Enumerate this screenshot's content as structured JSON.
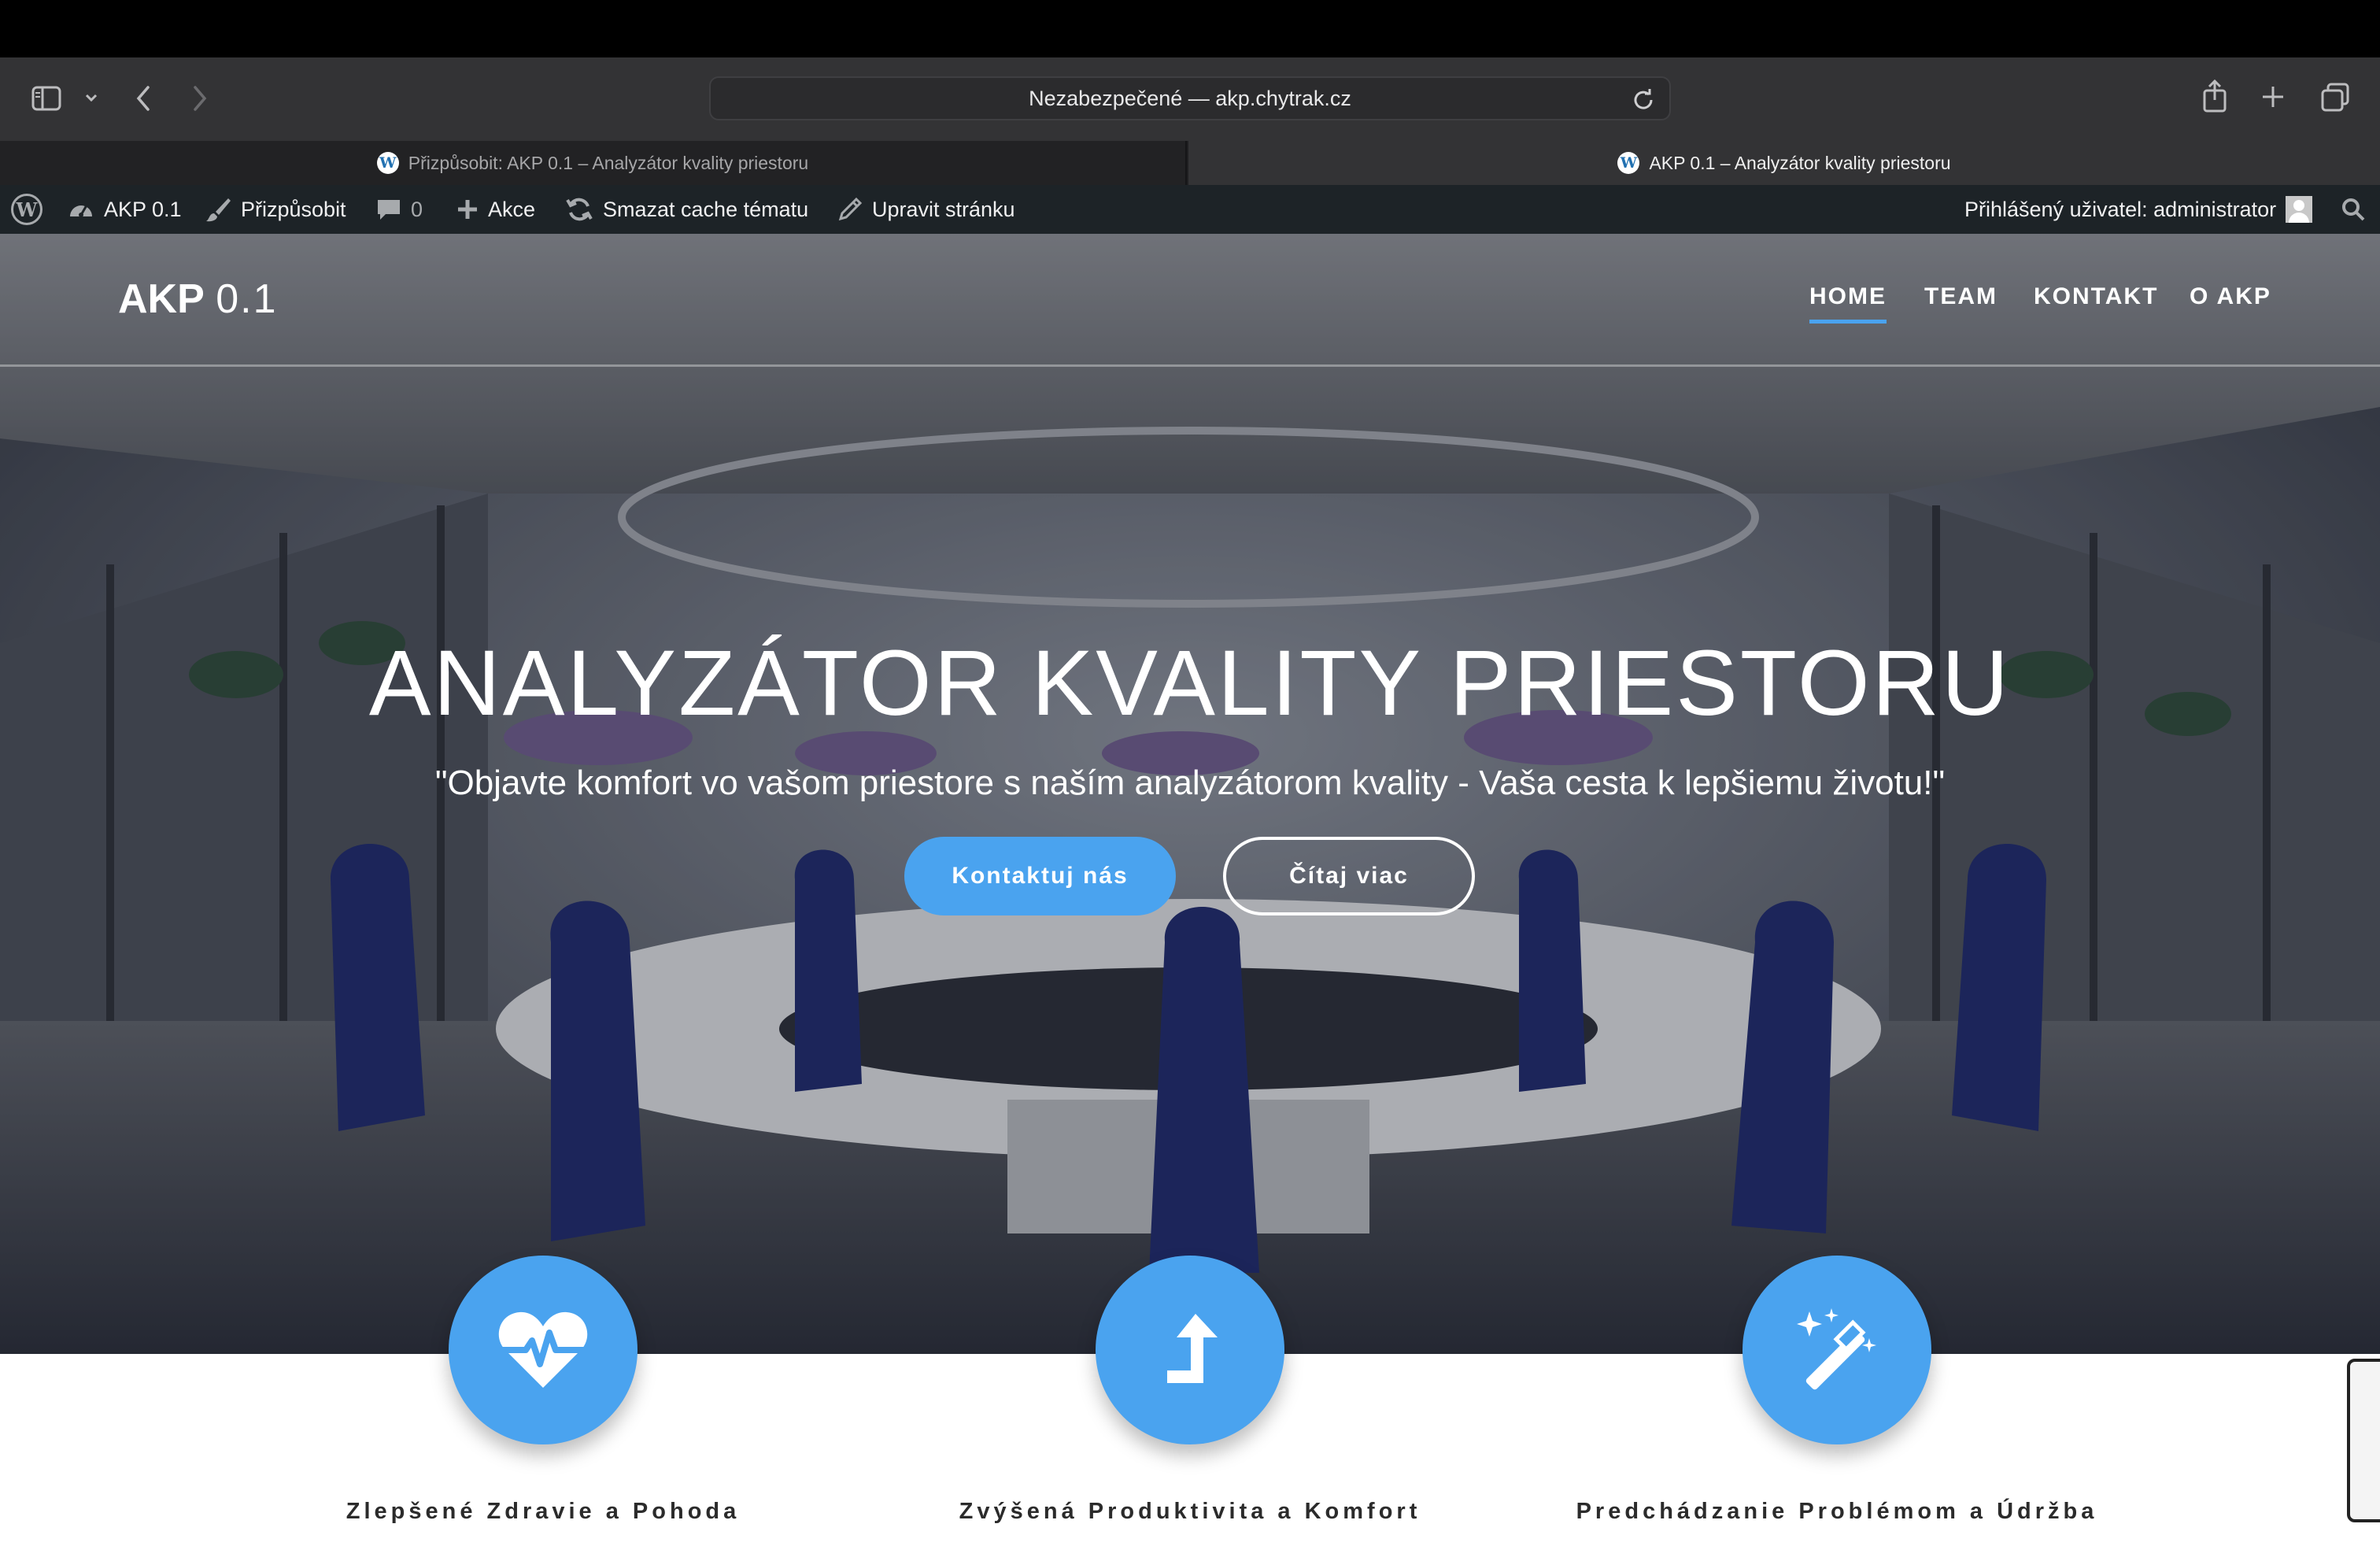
{
  "browser": {
    "address": "Nezabezpečené — akp.chytrak.cz",
    "tabs": [
      {
        "label": "Přizpůsobit: AKP 0.1 – Analyzátor kvality priestoru",
        "active": false
      },
      {
        "label": "AKP 0.1 – Analyzátor kvality priestoru",
        "active": true
      }
    ]
  },
  "adminbar": {
    "site_name": "AKP 0.1",
    "customize": "Přizpůsobit",
    "comments_count": "0",
    "new_label": "Akce",
    "clear_cache": "Smazat cache tématu",
    "edit_page": "Upravit stránku",
    "user_greeting": "Přihlášený uživatel: administrator"
  },
  "site": {
    "logo_bold": "AKP",
    "logo_version": "0.1",
    "nav": [
      {
        "label": "HOME",
        "active": true
      },
      {
        "label": "TEAM",
        "active": false
      },
      {
        "label": "KONTAKT",
        "active": false
      },
      {
        "label": "O AKP",
        "active": false
      }
    ]
  },
  "hero": {
    "title": "ANALYZÁTOR KVALITY PRIESTORU",
    "subtitle": "\"Objavte komfort vo vašom priestore s naším analyzátorom kvality - Vaša cesta k lepšiemu životu!\"",
    "primary_button": "Kontaktuj nás",
    "secondary_button": "Čítaj viac"
  },
  "features": [
    {
      "title": "Zlepšené Zdravie a Pohoda",
      "icon": "heartbeat-icon"
    },
    {
      "title": "Zvýšená Produktivita a Komfort",
      "icon": "turn-up-arrow-icon"
    },
    {
      "title": "Predchádzanie Problémom a Údržba",
      "icon": "magic-wand-icon"
    }
  ],
  "colors": {
    "accent": "#4aa3ef",
    "adminbar": "#1d2327",
    "toolbar": "#333335"
  }
}
